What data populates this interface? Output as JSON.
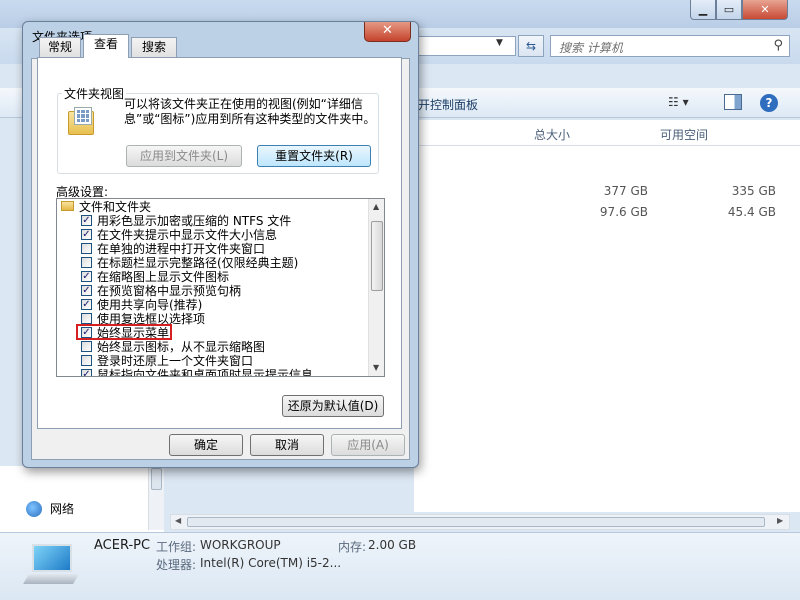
{
  "explorer": {
    "search_placeholder": "搜索 计算机",
    "control_panel_link": "打开控制面板",
    "control_panel_visible": "开控制面板",
    "col_total": "总大小",
    "col_free": "可用空间",
    "drives": [
      {
        "total": "377 GB",
        "free": "335 GB"
      },
      {
        "total": "97.6 GB",
        "free": "45.4 GB"
      }
    ],
    "network": "网络",
    "pc_name": "ACER-PC",
    "workgroup_label": "工作组:",
    "workgroup": "WORKGROUP",
    "memory_label": "内存:",
    "memory": "2.00 GB",
    "cpu_label": "处理器:",
    "cpu": "Intel(R) Core(TM) i5-2...",
    "menu_stub": "文",
    "left_stub": "文"
  },
  "dialog": {
    "title": "文件夹选项",
    "close": "✕",
    "tabs": [
      "常规",
      "查看",
      "搜索"
    ],
    "active_tab": "查看",
    "group_title": "文件夹视图",
    "description": "可以将该文件夹正在使用的视图(例如“详细信息”或“图标”)应用到所有这种类型的文件夹中。",
    "apply_button": "应用到文件夹(L)",
    "reset_button": "重置文件夹(R)",
    "advanced_label": "高级设置:",
    "tree_root": "文件和文件夹",
    "options": [
      {
        "label": "用彩色显示加密或压缩的 NTFS 文件",
        "checked": true
      },
      {
        "label": "在文件夹提示中显示文件大小信息",
        "checked": true
      },
      {
        "label": "在单独的进程中打开文件夹窗口",
        "checked": false
      },
      {
        "label": "在标题栏显示完整路径(仅限经典主题)",
        "checked": false
      },
      {
        "label": "在缩略图上显示文件图标",
        "checked": true
      },
      {
        "label": "在预览窗格中显示预览句柄",
        "checked": true
      },
      {
        "label": "使用共享向导(推荐)",
        "checked": true
      },
      {
        "label": "使用复选框以选择项",
        "checked": false
      },
      {
        "label": "始终显示菜单",
        "checked": true
      },
      {
        "label": "始终显示图标，从不显示缩略图",
        "checked": false
      },
      {
        "label": "登录时还原上一个文件夹窗口",
        "checked": false
      },
      {
        "label": "鼠标指向文件夹和桌面项时显示提示信息",
        "checked": true
      }
    ],
    "restore_defaults": "还原为默认值(D)",
    "ok": "确定",
    "cancel": "取消",
    "apply": "应用(A)"
  },
  "colors": {
    "highlight_box": "#d42020",
    "close_button": "#c4432c"
  }
}
